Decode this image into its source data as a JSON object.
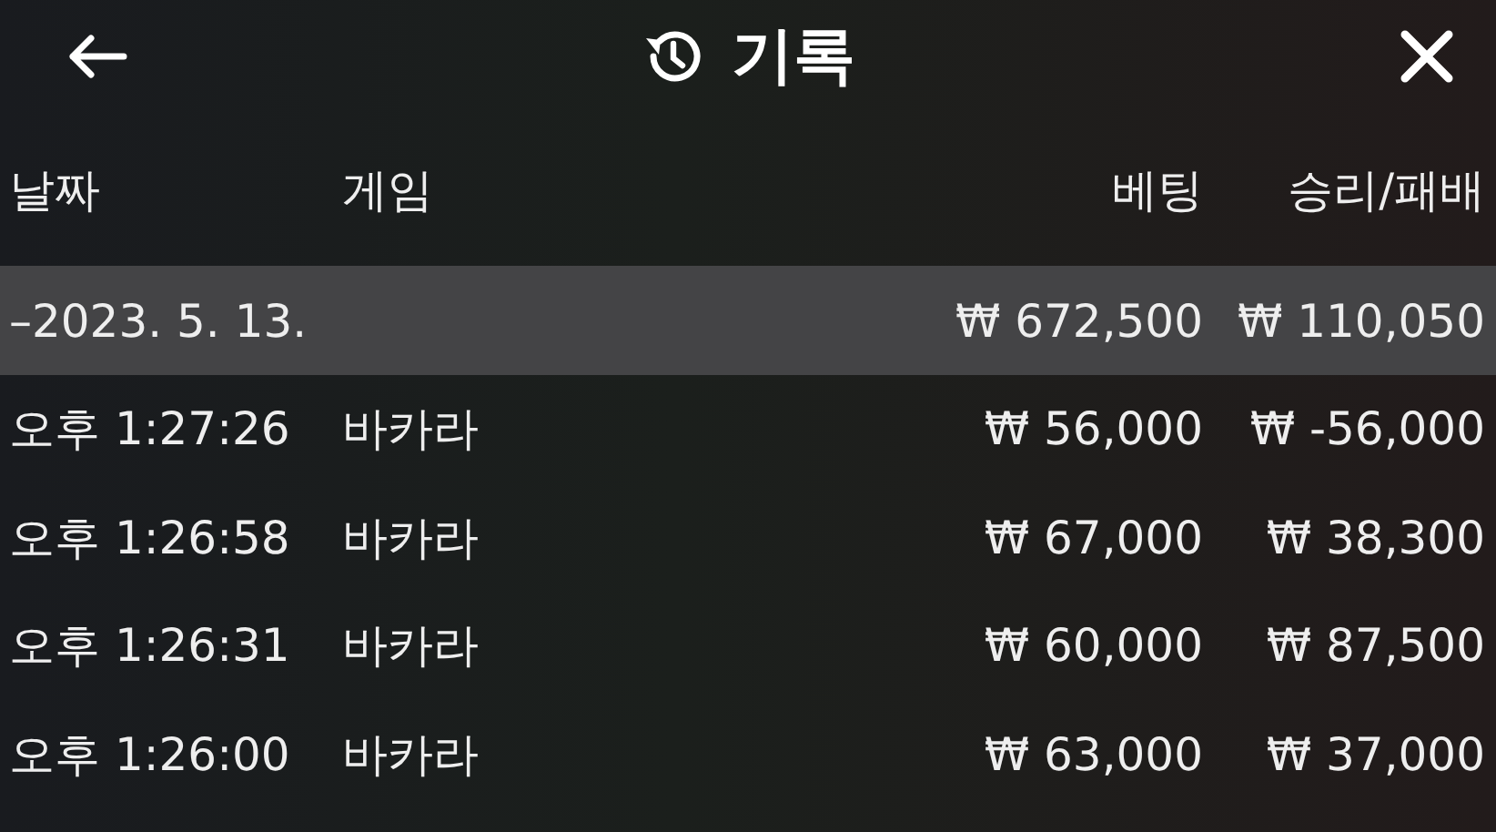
{
  "header": {
    "title": "기록"
  },
  "table": {
    "columns": [
      "날짜",
      "게임",
      "베팅",
      "승리/패배"
    ],
    "group": {
      "date": "–2023. 5. 13.",
      "bet": "₩ 672,500",
      "result": "₩ 110,050"
    },
    "rows": [
      {
        "time": "오후 1:27:26",
        "game": "바카라",
        "bet": "₩ 56,000",
        "result": "₩ -56,000"
      },
      {
        "time": "오후 1:26:58",
        "game": "바카라",
        "bet": "₩ 67,000",
        "result": "₩ 38,300"
      },
      {
        "time": "오후 1:26:31",
        "game": "바카라",
        "bet": "₩ 60,000",
        "result": "₩ 87,500"
      },
      {
        "time": "오후 1:26:00",
        "game": "바카라",
        "bet": "₩ 63,000",
        "result": "₩ 37,000"
      }
    ]
  }
}
